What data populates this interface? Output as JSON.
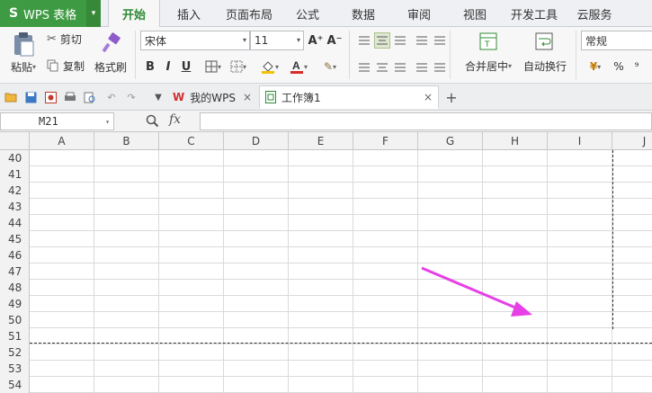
{
  "app": {
    "logo": "S",
    "title": "WPS 表格",
    "menu_arrow": "▾"
  },
  "menu": {
    "tabs": [
      "开始",
      "插入",
      "页面布局",
      "公式",
      "数据",
      "审阅",
      "视图",
      "开发工具",
      "云服务"
    ],
    "active_tab": "开始"
  },
  "ribbon": {
    "paste": "粘贴",
    "paste_drop": "▾",
    "cut": "剪切",
    "copy": "复制",
    "format_painter": "格式刷",
    "font_name": "宋体",
    "font_size": "11",
    "grow_font": "A⁺",
    "shrink_font": "A⁻",
    "bold": "B",
    "italic": "I",
    "underline": "U",
    "merge_center": "合并居中",
    "wrap_text": "自动换行",
    "number_format": "常规",
    "percent": "%",
    "comma": "⁹",
    "dropdown": "▾",
    "font_color_accent": "#d92b2b",
    "fill_color_accent": "#f2c200"
  },
  "tabbar": {
    "tabs": [
      {
        "label": "我的WPS",
        "close": "×"
      },
      {
        "label": "工作簿1",
        "close": "×"
      }
    ],
    "add": "+",
    "menu_arrow": "▼"
  },
  "formula_bar": {
    "name_box": "M21",
    "name_drop": "▾",
    "zoom_icon": "🔍",
    "fx": "fx",
    "value": ""
  },
  "grid": {
    "columns": [
      "A",
      "B",
      "C",
      "D",
      "E",
      "F",
      "G",
      "H",
      "I",
      "J"
    ],
    "rows": [
      "40",
      "41",
      "42",
      "43",
      "44",
      "45",
      "46",
      "47",
      "48",
      "49",
      "50",
      "51",
      "52",
      "53",
      "54"
    ]
  },
  "annotation": {
    "arrow_color": "#e640e6"
  }
}
